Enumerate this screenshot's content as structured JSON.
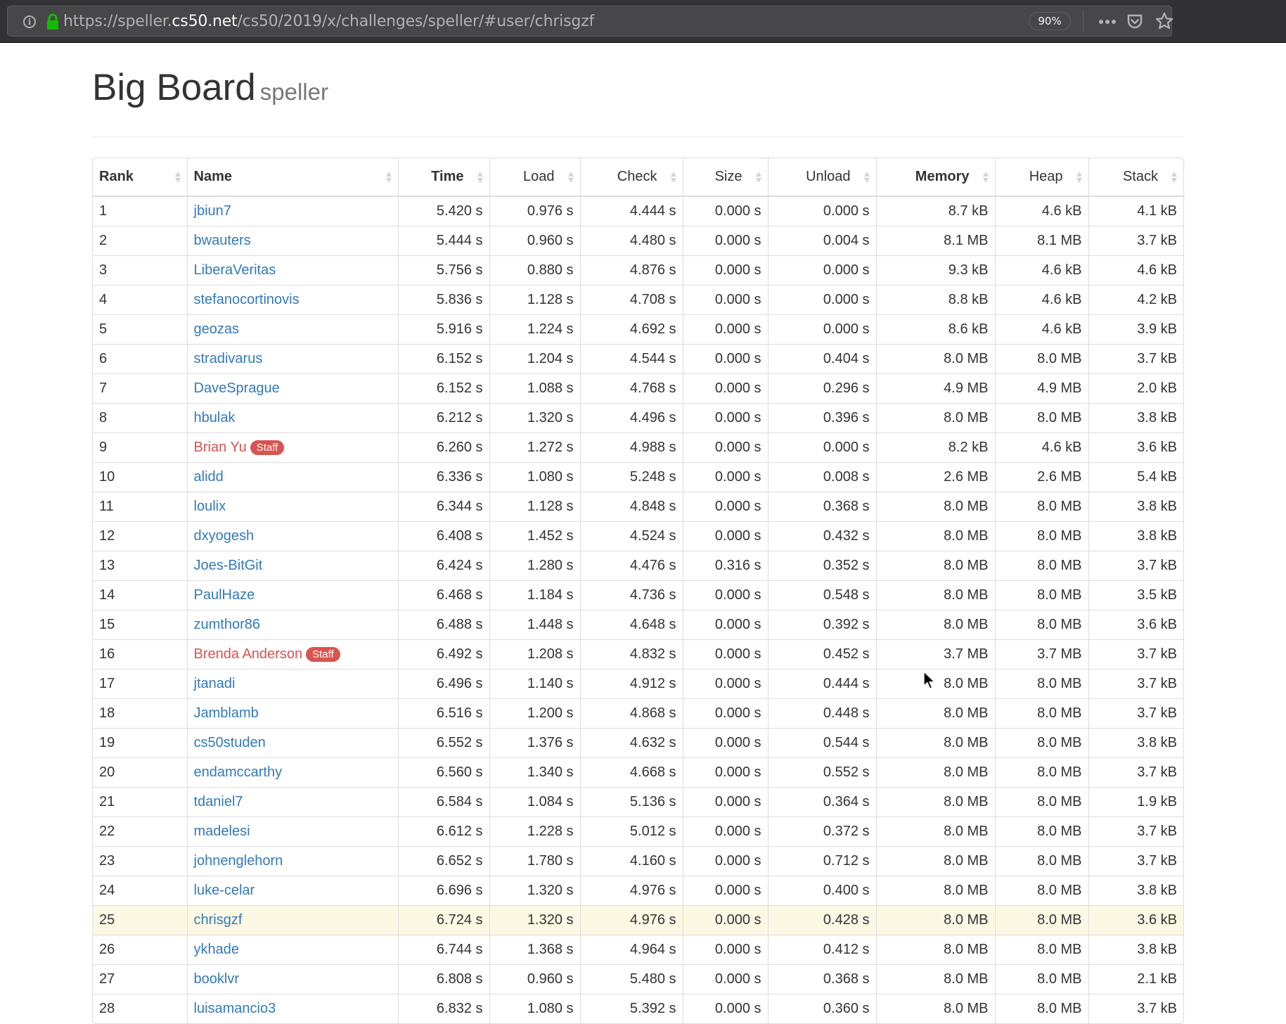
{
  "browser": {
    "url_prefix": "https://speller.",
    "url_domain": "cs50.net",
    "url_path": "/cs50/2019/x/challenges/speller/#user/chrisgzf",
    "zoom": "90%",
    "icons": [
      "info-icon",
      "lock-icon",
      "more-icon",
      "pocket-icon",
      "star-icon"
    ]
  },
  "page": {
    "title": "Big Board",
    "subtitle": "speller"
  },
  "table": {
    "columns": [
      {
        "key": "rank",
        "label": "Rank"
      },
      {
        "key": "name",
        "label": "Name"
      },
      {
        "key": "time",
        "label": "Time"
      },
      {
        "key": "load",
        "label": "Load"
      },
      {
        "key": "check",
        "label": "Check"
      },
      {
        "key": "size",
        "label": "Size"
      },
      {
        "key": "unload",
        "label": "Unload"
      },
      {
        "key": "memory",
        "label": "Memory"
      },
      {
        "key": "heap",
        "label": "Heap"
      },
      {
        "key": "stack",
        "label": "Stack"
      }
    ],
    "staff_badge": "Staff",
    "highlighted_user": "chrisgzf",
    "colors": {
      "link": "#337ab7",
      "staff": "#d9534f",
      "highlight": "#fcf8e3"
    },
    "rows": [
      {
        "rank": "1",
        "name": "jbiun7",
        "staff": false,
        "time": "5.420 s",
        "load": "0.976 s",
        "check": "4.444 s",
        "size": "0.000 s",
        "unload": "0.000 s",
        "memory": "8.7 kB",
        "heap": "4.6 kB",
        "stack": "4.1 kB"
      },
      {
        "rank": "2",
        "name": "bwauters",
        "staff": false,
        "time": "5.444 s",
        "load": "0.960 s",
        "check": "4.480 s",
        "size": "0.000 s",
        "unload": "0.004 s",
        "memory": "8.1 MB",
        "heap": "8.1 MB",
        "stack": "3.7 kB"
      },
      {
        "rank": "3",
        "name": "LiberaVeritas",
        "staff": false,
        "time": "5.756 s",
        "load": "0.880 s",
        "check": "4.876 s",
        "size": "0.000 s",
        "unload": "0.000 s",
        "memory": "9.3 kB",
        "heap": "4.6 kB",
        "stack": "4.6 kB"
      },
      {
        "rank": "4",
        "name": "stefanocortinovis",
        "staff": false,
        "time": "5.836 s",
        "load": "1.128 s",
        "check": "4.708 s",
        "size": "0.000 s",
        "unload": "0.000 s",
        "memory": "8.8 kB",
        "heap": "4.6 kB",
        "stack": "4.2 kB"
      },
      {
        "rank": "5",
        "name": "geozas",
        "staff": false,
        "time": "5.916 s",
        "load": "1.224 s",
        "check": "4.692 s",
        "size": "0.000 s",
        "unload": "0.000 s",
        "memory": "8.6 kB",
        "heap": "4.6 kB",
        "stack": "3.9 kB"
      },
      {
        "rank": "6",
        "name": "stradivarus",
        "staff": false,
        "time": "6.152 s",
        "load": "1.204 s",
        "check": "4.544 s",
        "size": "0.000 s",
        "unload": "0.404 s",
        "memory": "8.0 MB",
        "heap": "8.0 MB",
        "stack": "3.7 kB"
      },
      {
        "rank": "7",
        "name": "DaveSprague",
        "staff": false,
        "time": "6.152 s",
        "load": "1.088 s",
        "check": "4.768 s",
        "size": "0.000 s",
        "unload": "0.296 s",
        "memory": "4.9 MB",
        "heap": "4.9 MB",
        "stack": "2.0 kB"
      },
      {
        "rank": "8",
        "name": "hbulak",
        "staff": false,
        "time": "6.212 s",
        "load": "1.320 s",
        "check": "4.496 s",
        "size": "0.000 s",
        "unload": "0.396 s",
        "memory": "8.0 MB",
        "heap": "8.0 MB",
        "stack": "3.8 kB"
      },
      {
        "rank": "9",
        "name": "Brian Yu",
        "staff": true,
        "time": "6.260 s",
        "load": "1.272 s",
        "check": "4.988 s",
        "size": "0.000 s",
        "unload": "0.000 s",
        "memory": "8.2 kB",
        "heap": "4.6 kB",
        "stack": "3.6 kB"
      },
      {
        "rank": "10",
        "name": "alidd",
        "staff": false,
        "time": "6.336 s",
        "load": "1.080 s",
        "check": "5.248 s",
        "size": "0.000 s",
        "unload": "0.008 s",
        "memory": "2.6 MB",
        "heap": "2.6 MB",
        "stack": "5.4 kB"
      },
      {
        "rank": "11",
        "name": "loulix",
        "staff": false,
        "time": "6.344 s",
        "load": "1.128 s",
        "check": "4.848 s",
        "size": "0.000 s",
        "unload": "0.368 s",
        "memory": "8.0 MB",
        "heap": "8.0 MB",
        "stack": "3.8 kB"
      },
      {
        "rank": "12",
        "name": "dxyogesh",
        "staff": false,
        "time": "6.408 s",
        "load": "1.452 s",
        "check": "4.524 s",
        "size": "0.000 s",
        "unload": "0.432 s",
        "memory": "8.0 MB",
        "heap": "8.0 MB",
        "stack": "3.8 kB"
      },
      {
        "rank": "13",
        "name": "Joes-BitGit",
        "staff": false,
        "time": "6.424 s",
        "load": "1.280 s",
        "check": "4.476 s",
        "size": "0.316 s",
        "unload": "0.352 s",
        "memory": "8.0 MB",
        "heap": "8.0 MB",
        "stack": "3.7 kB"
      },
      {
        "rank": "14",
        "name": "PaulHaze",
        "staff": false,
        "time": "6.468 s",
        "load": "1.184 s",
        "check": "4.736 s",
        "size": "0.000 s",
        "unload": "0.548 s",
        "memory": "8.0 MB",
        "heap": "8.0 MB",
        "stack": "3.5 kB"
      },
      {
        "rank": "15",
        "name": "zumthor86",
        "staff": false,
        "time": "6.488 s",
        "load": "1.448 s",
        "check": "4.648 s",
        "size": "0.000 s",
        "unload": "0.392 s",
        "memory": "8.0 MB",
        "heap": "8.0 MB",
        "stack": "3.6 kB"
      },
      {
        "rank": "16",
        "name": "Brenda Anderson",
        "staff": true,
        "time": "6.492 s",
        "load": "1.208 s",
        "check": "4.832 s",
        "size": "0.000 s",
        "unload": "0.452 s",
        "memory": "3.7 MB",
        "heap": "3.7 MB",
        "stack": "3.7 kB"
      },
      {
        "rank": "17",
        "name": "jtanadi",
        "staff": false,
        "time": "6.496 s",
        "load": "1.140 s",
        "check": "4.912 s",
        "size": "0.000 s",
        "unload": "0.444 s",
        "memory": "8.0 MB",
        "heap": "8.0 MB",
        "stack": "3.7 kB"
      },
      {
        "rank": "18",
        "name": "Jamblamb",
        "staff": false,
        "time": "6.516 s",
        "load": "1.200 s",
        "check": "4.868 s",
        "size": "0.000 s",
        "unload": "0.448 s",
        "memory": "8.0 MB",
        "heap": "8.0 MB",
        "stack": "3.7 kB"
      },
      {
        "rank": "19",
        "name": "cs50studen",
        "staff": false,
        "time": "6.552 s",
        "load": "1.376 s",
        "check": "4.632 s",
        "size": "0.000 s",
        "unload": "0.544 s",
        "memory": "8.0 MB",
        "heap": "8.0 MB",
        "stack": "3.8 kB"
      },
      {
        "rank": "20",
        "name": "endamccarthy",
        "staff": false,
        "time": "6.560 s",
        "load": "1.340 s",
        "check": "4.668 s",
        "size": "0.000 s",
        "unload": "0.552 s",
        "memory": "8.0 MB",
        "heap": "8.0 MB",
        "stack": "3.7 kB"
      },
      {
        "rank": "21",
        "name": "tdaniel7",
        "staff": false,
        "time": "6.584 s",
        "load": "1.084 s",
        "check": "5.136 s",
        "size": "0.000 s",
        "unload": "0.364 s",
        "memory": "8.0 MB",
        "heap": "8.0 MB",
        "stack": "1.9 kB"
      },
      {
        "rank": "22",
        "name": "madelesi",
        "staff": false,
        "time": "6.612 s",
        "load": "1.228 s",
        "check": "5.012 s",
        "size": "0.000 s",
        "unload": "0.372 s",
        "memory": "8.0 MB",
        "heap": "8.0 MB",
        "stack": "3.7 kB"
      },
      {
        "rank": "23",
        "name": "johnenglehorn",
        "staff": false,
        "time": "6.652 s",
        "load": "1.780 s",
        "check": "4.160 s",
        "size": "0.000 s",
        "unload": "0.712 s",
        "memory": "8.0 MB",
        "heap": "8.0 MB",
        "stack": "3.7 kB"
      },
      {
        "rank": "24",
        "name": "luke-celar",
        "staff": false,
        "time": "6.696 s",
        "load": "1.320 s",
        "check": "4.976 s",
        "size": "0.000 s",
        "unload": "0.400 s",
        "memory": "8.0 MB",
        "heap": "8.0 MB",
        "stack": "3.8 kB"
      },
      {
        "rank": "25",
        "name": "chrisgzf",
        "staff": false,
        "time": "6.724 s",
        "load": "1.320 s",
        "check": "4.976 s",
        "size": "0.000 s",
        "unload": "0.428 s",
        "memory": "8.0 MB",
        "heap": "8.0 MB",
        "stack": "3.6 kB"
      },
      {
        "rank": "26",
        "name": "ykhade",
        "staff": false,
        "time": "6.744 s",
        "load": "1.368 s",
        "check": "4.964 s",
        "size": "0.000 s",
        "unload": "0.412 s",
        "memory": "8.0 MB",
        "heap": "8.0 MB",
        "stack": "3.8 kB"
      },
      {
        "rank": "27",
        "name": "booklvr",
        "staff": false,
        "time": "6.808 s",
        "load": "0.960 s",
        "check": "5.480 s",
        "size": "0.000 s",
        "unload": "0.368 s",
        "memory": "8.0 MB",
        "heap": "8.0 MB",
        "stack": "2.1 kB"
      },
      {
        "rank": "28",
        "name": "luisamancio3",
        "staff": false,
        "time": "6.832 s",
        "load": "1.080 s",
        "check": "5.392 s",
        "size": "0.000 s",
        "unload": "0.360 s",
        "memory": "8.0 MB",
        "heap": "8.0 MB",
        "stack": "3.7 kB"
      }
    ]
  }
}
